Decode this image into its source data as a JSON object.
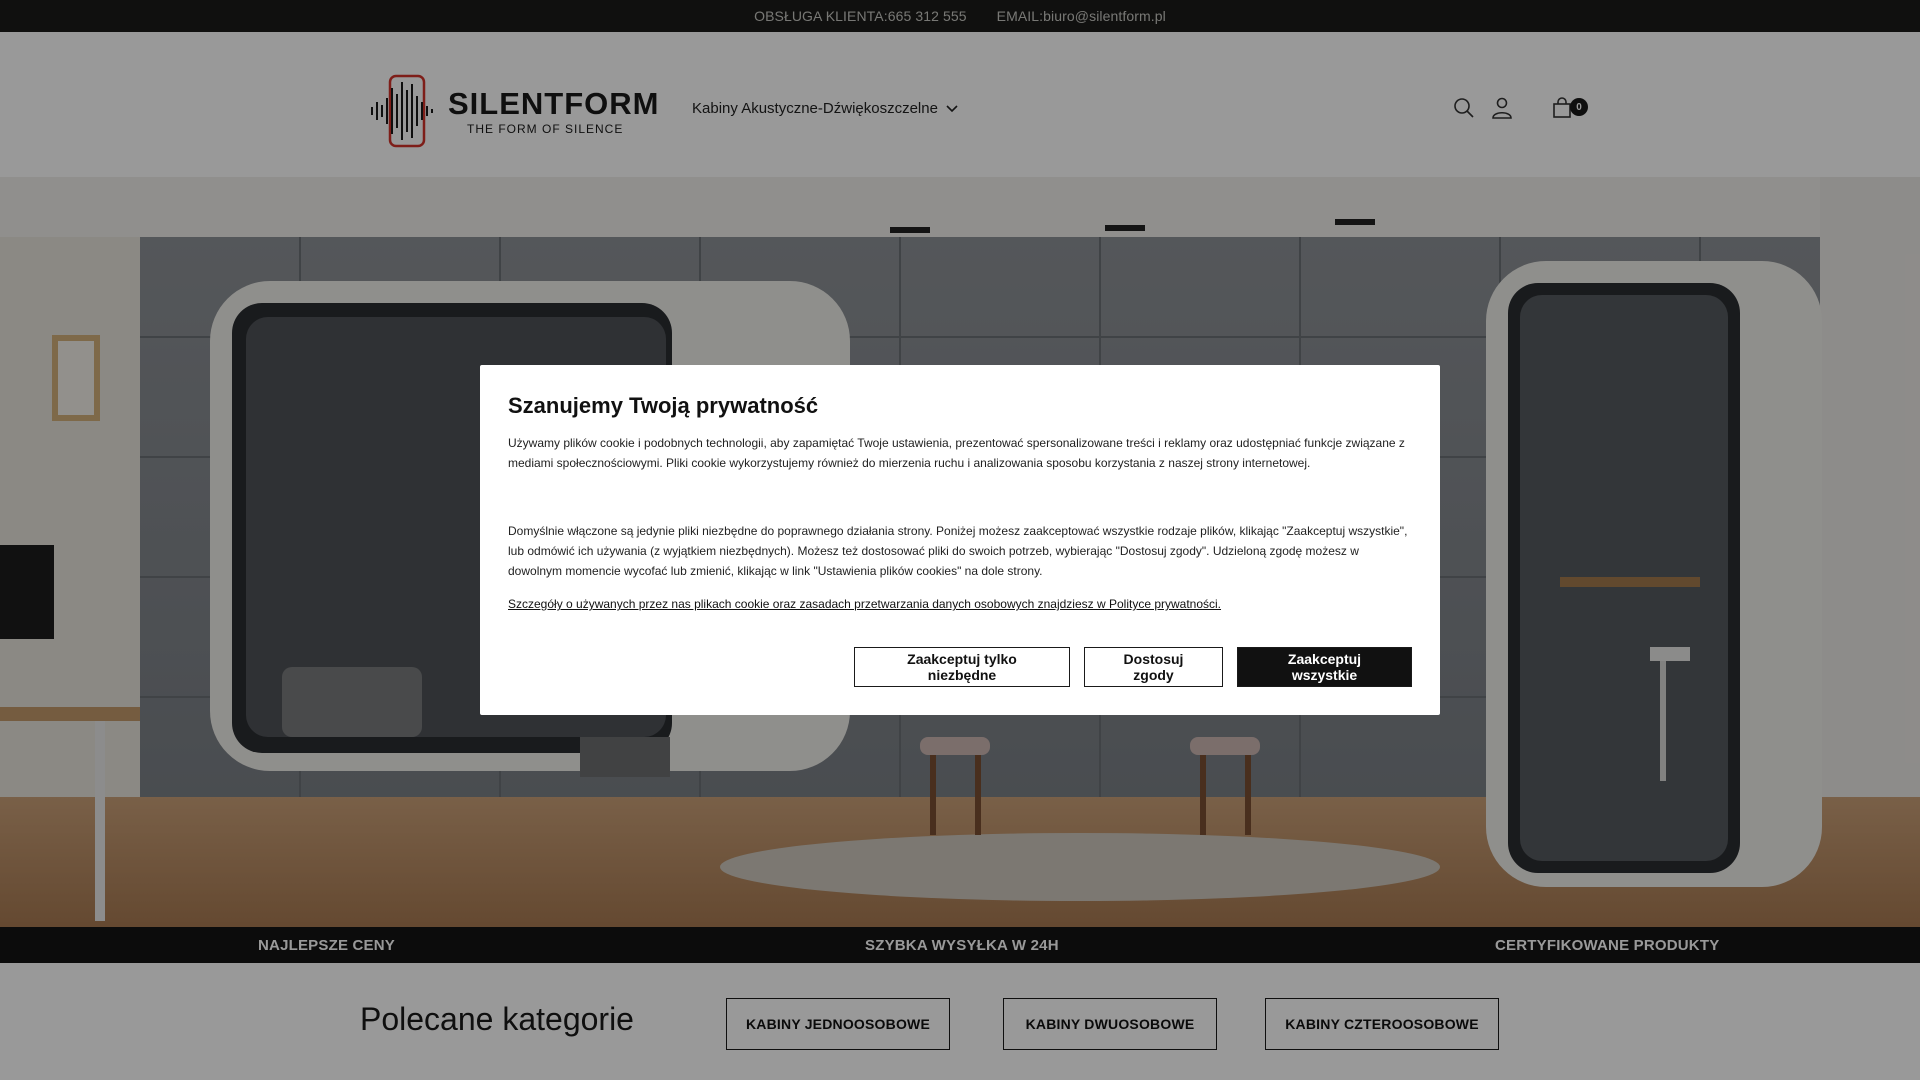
{
  "topbar": {
    "phone": "OBSŁUGA KLIENTA:665 312 555",
    "email": "EMAIL:biuro@silentform.pl"
  },
  "header": {
    "logo_title": "SILENTFORM",
    "logo_subtitle": "THE FORM OF SILENCE",
    "nav_item": "Kabiny Akustyczne-Dźwiękoszczelne",
    "cart_count": "0",
    "icons": [
      "search-icon",
      "user-icon",
      "cart-icon"
    ]
  },
  "strip": {
    "item1": "NAJLEPSZE CENY",
    "item2": "SZYBKA WYSYŁKA W 24H",
    "item3": "CERTYFIKOWANE PRODUKTY"
  },
  "categories": {
    "title": "Polecane kategorie",
    "buttons": [
      "KABINY JEDNOOSOBOWE",
      "KABINY DWUOSOBOWE",
      "KABINY CZTEROOSOBOWE"
    ]
  },
  "cookie": {
    "title": "Szanujemy Twoją prywatność",
    "paragraph1": "Używamy plików cookie i podobnych technologii, aby zapamiętać Twoje ustawienia, prezentować spersonalizowane treści i reklamy oraz udostępniać funkcje związane z mediami społecznościowymi. Pliki cookie wykorzystujemy również do mierzenia ruchu i analizowania sposobu korzystania z naszej strony internetowej.",
    "paragraph2": "Domyślnie włączone są jedynie pliki niezbędne do poprawnego działania strony. Poniżej możesz zaakceptować wszystkie rodzaje plików, klikając \"Zaakceptuj wszystkie\", lub odmówić ich używania (z wyjątkiem niezbędnych). Możesz też dostosować pliki do swoich potrzeb, wybierając \"Dostosuj zgody\". Udzieloną zgodę możesz w dowolnym momencie wycofać lub zmienić, klikając w link \"Ustawienia plików cookies\" na dole strony.",
    "link": "Szczegóły o używanych przez nas plikach cookie oraz zasadach przetwarzania danych osobowych znajdziesz w Polityce prywatności.",
    "btn_necessary": "Zaakceptuj tylko niezbędne",
    "btn_customize": "Dostosuj zgody",
    "btn_accept_all": "Zaakceptuj wszystkie"
  },
  "colors": {
    "topbar_bg": "#1c1c1a",
    "strip_bg": "#141414",
    "logo_accent": "#d2332a",
    "primary_button": "#111111"
  }
}
